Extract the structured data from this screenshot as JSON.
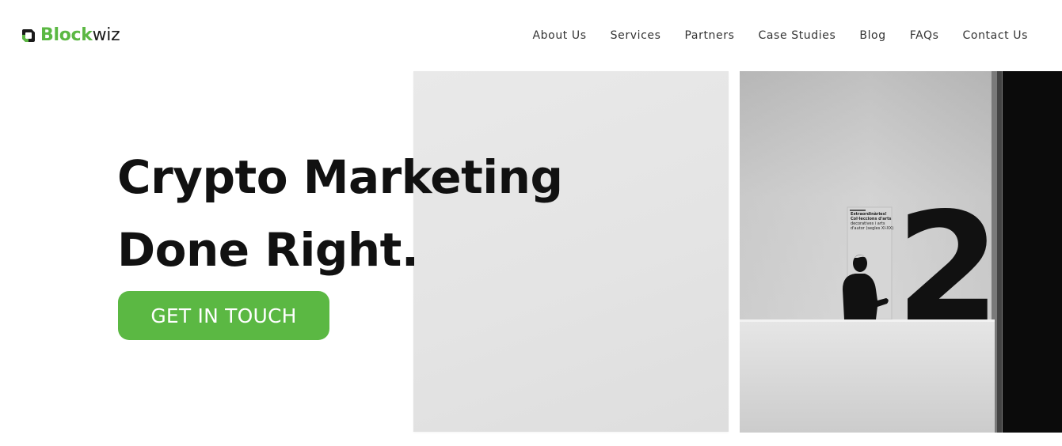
{
  "brand": {
    "name_part_a": "Block",
    "name_part_b": "wiz",
    "logo_icon": "blockwiz-logo-icon",
    "green": "#5bb843"
  },
  "nav": {
    "items": [
      {
        "label": "About Us"
      },
      {
        "label": "Services"
      },
      {
        "label": "Partners"
      },
      {
        "label": "Case Studies"
      },
      {
        "label": "Blog"
      },
      {
        "label": "FAQs"
      },
      {
        "label": "Contact Us"
      }
    ]
  },
  "hero": {
    "heading_line1": "Crypto Marketing",
    "heading_line2": "Done Right.",
    "cta_label": "GET IN TOUCH",
    "photo": {
      "big_numeral": "2",
      "placard_line1": "Extraordinàries!",
      "placard_line2": "Col·leccions d'arts",
      "placard_line3": "decoratives i arts",
      "placard_line4": "d'autor (segles XI-XX)"
    }
  }
}
